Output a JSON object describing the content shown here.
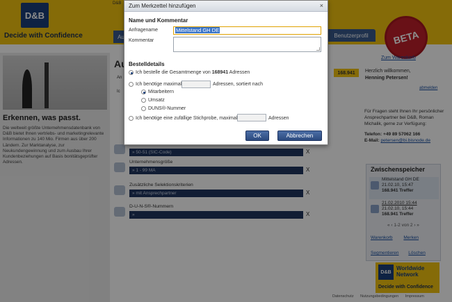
{
  "header": {
    "logo_text": "D&B",
    "logo_tagline": "Decide with Confidence",
    "top_snippet": "D&B",
    "tab_aus": "Au",
    "tab_user": "Benutzerprofil",
    "beta_label": "BETA"
  },
  "left": {
    "title": "Erkennen, was passt.",
    "text": "Die weltweit größte Unternehmensdatenbank von D&B bietet Ihnen vertriebs- und marketingrelevante Informationen zu 140 Mio. Firmen aus über 200 Ländern. Zur Marktanalyse, zur Neukundengewinnung und zum Ausbau Ihrer Kundenbeziehungen auf Basis bonitätsgeprüfter Adressen."
  },
  "main": {
    "heading": "Au",
    "count": "168.941",
    "an_text": "An",
    "ic_text": "Ic",
    "criteria": [
      {
        "label": "",
        "value": "» 50-51 (SIC-Code)"
      },
      {
        "label": "Unternehmensgröße",
        "value": "» 1 - 99 MA"
      },
      {
        "label": "Zusätzliche Selektionskriterien",
        "value": "» mit Ansprechpartner"
      },
      {
        "label": "D-U-N-S®-Nummern",
        "value": "»"
      }
    ],
    "remove_label": "X"
  },
  "right": {
    "cart_link": "Zum Warenkorb",
    "welcome_line": "Herzlich willkommen,",
    "user_name": "Henning Petersen!",
    "logout": "abmelden",
    "contact_text": "Für Fragen steht Ihnen Ihr persönlicher Ansprechpartner bei D&B, Roman Michalik, gerne zur Verfügung:",
    "phone": "Telefon: +49 89 57062 166",
    "email_label": "E-Mail:",
    "email": "petersen@bi.bisnode.de",
    "clipboard": {
      "title": "Zwischenspeicher",
      "items": [
        {
          "name": "Mittelstand GH DE",
          "date": "21.02.10, 15:47",
          "hits": "168.941 Treffer"
        },
        {
          "name": "21.02.2010 15:44",
          "date": "21.02.10, 15:44",
          "hits": "168.941 Treffer"
        }
      ],
      "pager": "1-2 von 2",
      "action_cart": "Warenkorb",
      "action_remember": "Merken",
      "action_segment": "Segmentieren",
      "action_delete": "Löschen"
    },
    "ww_db": "D&B",
    "ww_title": "Worldwide Network",
    "ww_tagline": "Decide with Confidence"
  },
  "footer": {
    "links": [
      "Datenschutz",
      "Nutzungsbedingungen",
      "Impressum"
    ]
  },
  "dialog": {
    "title": "Zum Merkzettel hinzufügen",
    "close_icon": "×",
    "section_name": "Name und Kommentar",
    "label_name": "Anfragename",
    "name_value": "Mittelstand GH DE",
    "label_comment": "Kommentar",
    "comment_value": "",
    "section_order": "Bestelldetails",
    "option_total_prefix": "Ich bestelle die Gesamtmenge von ",
    "option_total_count": "168941",
    "option_total_suffix": " Adressen",
    "option_max_prefix": "Ich benötige maximal",
    "option_max_suffix": "Adressen, sortiert nach",
    "sort_options": [
      "Mitarbeitern",
      "Umsatz",
      "DUNS®-Nummer"
    ],
    "option_sample_prefix": "Ich benötige eine zufällige Stichprobe, maximal",
    "option_sample_suffix": "Adressen",
    "ok_label": "OK",
    "cancel_label": "Abbrechen"
  }
}
